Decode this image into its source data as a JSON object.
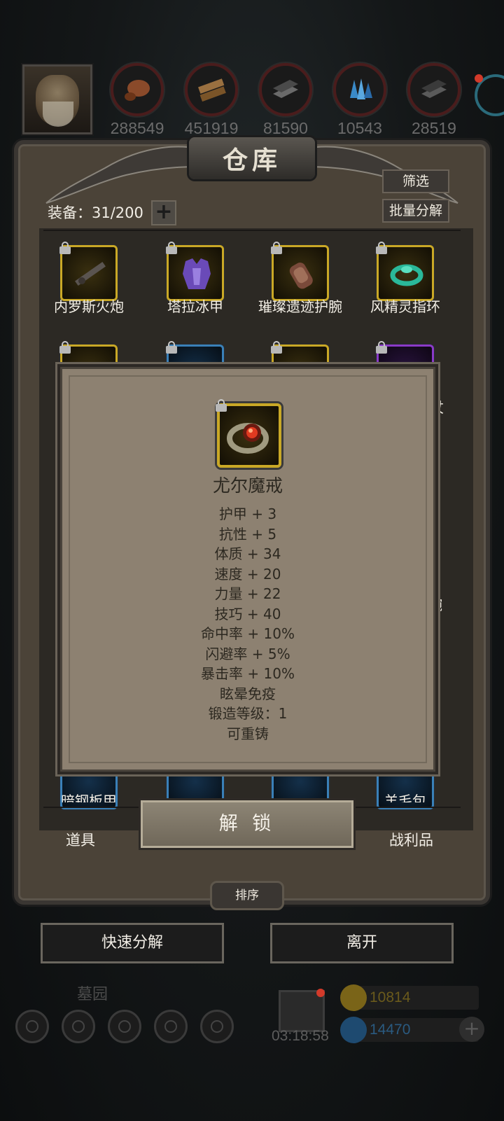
{
  "resources": [
    {
      "name": "meat-icon",
      "count": "288549",
      "color": "#8a4a2a"
    },
    {
      "name": "wood-icon",
      "count": "451919",
      "color": "#9a7040"
    },
    {
      "name": "iron-icon",
      "count": "81590",
      "color": "#5a5a5a"
    },
    {
      "name": "crystal-icon",
      "count": "10543",
      "color": "#3a8ac8"
    },
    {
      "name": "ore-icon",
      "count": "28519",
      "color": "#4a4a4a"
    }
  ],
  "warehouse": {
    "title": "仓库",
    "filter_label": "筛选",
    "batch_decompose_label": "批量分解",
    "capacity_label": "装备：31/200",
    "add_symbol": "+"
  },
  "items_row1": [
    {
      "name": "内罗斯火炮",
      "icon": "cannon-icon",
      "rarity": "gold"
    },
    {
      "name": "塔拉冰甲",
      "icon": "armor-icon",
      "rarity": "gold"
    },
    {
      "name": "璀璨遗迹护腕",
      "icon": "bracer-icon",
      "rarity": "gold"
    },
    {
      "name": "风精灵指环",
      "icon": "ring-icon",
      "rarity": "gold"
    }
  ],
  "items_partial": {
    "row2_tail": "杖",
    "row3_tail": "腕",
    "row5": [
      "暗钢板甲",
      "",
      "",
      "羊毛包"
    ]
  },
  "tabs": {
    "items": "道具",
    "loot": "战利品"
  },
  "actions": {
    "unlock": "解 锁",
    "sort": "排序",
    "quick_decompose": "快速分解",
    "leave": "离开"
  },
  "detail": {
    "item_name": "尤尔魔戒",
    "item_icon": "demon-ring-icon",
    "stats": [
      "护甲 + 3",
      "抗性 + 5",
      "体质 + 34",
      "速度 + 20",
      "力量 + 22",
      "技巧 + 40",
      "命中率 + 10%",
      "闪避率 + 5%",
      "暴击率 + 10%",
      "眩晕免疫",
      "锻造等级：1",
      "可重铸"
    ]
  },
  "hud": {
    "location": "墓园",
    "timer": "03:18:58",
    "gold": "10814",
    "gems": "14470",
    "gold_color": "#c9a826",
    "gem_color": "#3a8ac8"
  }
}
